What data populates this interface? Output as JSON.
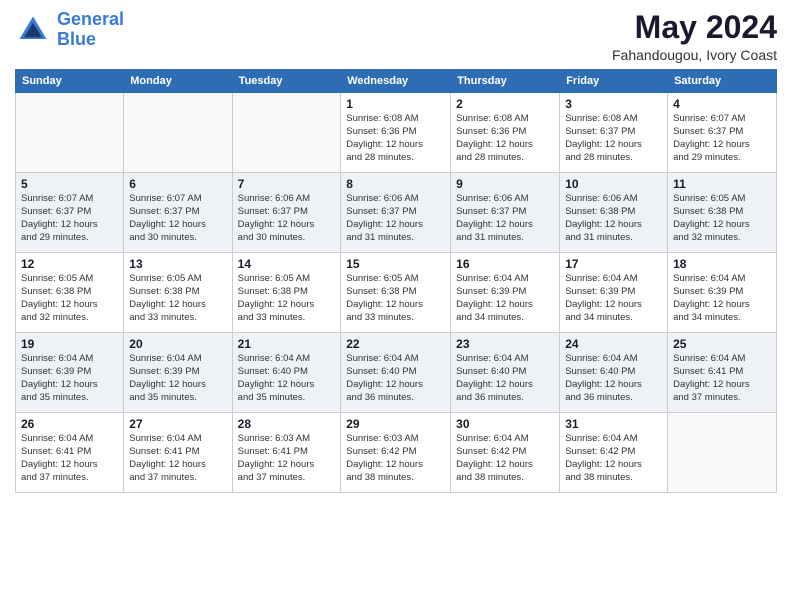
{
  "header": {
    "logo_line1": "General",
    "logo_line2": "Blue",
    "month": "May 2024",
    "location": "Fahandougou, Ivory Coast"
  },
  "weekdays": [
    "Sunday",
    "Monday",
    "Tuesday",
    "Wednesday",
    "Thursday",
    "Friday",
    "Saturday"
  ],
  "weeks": [
    [
      {
        "day": "",
        "info": ""
      },
      {
        "day": "",
        "info": ""
      },
      {
        "day": "",
        "info": ""
      },
      {
        "day": "1",
        "info": "Sunrise: 6:08 AM\nSunset: 6:36 PM\nDaylight: 12 hours\nand 28 minutes."
      },
      {
        "day": "2",
        "info": "Sunrise: 6:08 AM\nSunset: 6:36 PM\nDaylight: 12 hours\nand 28 minutes."
      },
      {
        "day": "3",
        "info": "Sunrise: 6:08 AM\nSunset: 6:37 PM\nDaylight: 12 hours\nand 28 minutes."
      },
      {
        "day": "4",
        "info": "Sunrise: 6:07 AM\nSunset: 6:37 PM\nDaylight: 12 hours\nand 29 minutes."
      }
    ],
    [
      {
        "day": "5",
        "info": "Sunrise: 6:07 AM\nSunset: 6:37 PM\nDaylight: 12 hours\nand 29 minutes."
      },
      {
        "day": "6",
        "info": "Sunrise: 6:07 AM\nSunset: 6:37 PM\nDaylight: 12 hours\nand 30 minutes."
      },
      {
        "day": "7",
        "info": "Sunrise: 6:06 AM\nSunset: 6:37 PM\nDaylight: 12 hours\nand 30 minutes."
      },
      {
        "day": "8",
        "info": "Sunrise: 6:06 AM\nSunset: 6:37 PM\nDaylight: 12 hours\nand 31 minutes."
      },
      {
        "day": "9",
        "info": "Sunrise: 6:06 AM\nSunset: 6:37 PM\nDaylight: 12 hours\nand 31 minutes."
      },
      {
        "day": "10",
        "info": "Sunrise: 6:06 AM\nSunset: 6:38 PM\nDaylight: 12 hours\nand 31 minutes."
      },
      {
        "day": "11",
        "info": "Sunrise: 6:05 AM\nSunset: 6:38 PM\nDaylight: 12 hours\nand 32 minutes."
      }
    ],
    [
      {
        "day": "12",
        "info": "Sunrise: 6:05 AM\nSunset: 6:38 PM\nDaylight: 12 hours\nand 32 minutes."
      },
      {
        "day": "13",
        "info": "Sunrise: 6:05 AM\nSunset: 6:38 PM\nDaylight: 12 hours\nand 33 minutes."
      },
      {
        "day": "14",
        "info": "Sunrise: 6:05 AM\nSunset: 6:38 PM\nDaylight: 12 hours\nand 33 minutes."
      },
      {
        "day": "15",
        "info": "Sunrise: 6:05 AM\nSunset: 6:38 PM\nDaylight: 12 hours\nand 33 minutes."
      },
      {
        "day": "16",
        "info": "Sunrise: 6:04 AM\nSunset: 6:39 PM\nDaylight: 12 hours\nand 34 minutes."
      },
      {
        "day": "17",
        "info": "Sunrise: 6:04 AM\nSunset: 6:39 PM\nDaylight: 12 hours\nand 34 minutes."
      },
      {
        "day": "18",
        "info": "Sunrise: 6:04 AM\nSunset: 6:39 PM\nDaylight: 12 hours\nand 34 minutes."
      }
    ],
    [
      {
        "day": "19",
        "info": "Sunrise: 6:04 AM\nSunset: 6:39 PM\nDaylight: 12 hours\nand 35 minutes."
      },
      {
        "day": "20",
        "info": "Sunrise: 6:04 AM\nSunset: 6:39 PM\nDaylight: 12 hours\nand 35 minutes."
      },
      {
        "day": "21",
        "info": "Sunrise: 6:04 AM\nSunset: 6:40 PM\nDaylight: 12 hours\nand 35 minutes."
      },
      {
        "day": "22",
        "info": "Sunrise: 6:04 AM\nSunset: 6:40 PM\nDaylight: 12 hours\nand 36 minutes."
      },
      {
        "day": "23",
        "info": "Sunrise: 6:04 AM\nSunset: 6:40 PM\nDaylight: 12 hours\nand 36 minutes."
      },
      {
        "day": "24",
        "info": "Sunrise: 6:04 AM\nSunset: 6:40 PM\nDaylight: 12 hours\nand 36 minutes."
      },
      {
        "day": "25",
        "info": "Sunrise: 6:04 AM\nSunset: 6:41 PM\nDaylight: 12 hours\nand 37 minutes."
      }
    ],
    [
      {
        "day": "26",
        "info": "Sunrise: 6:04 AM\nSunset: 6:41 PM\nDaylight: 12 hours\nand 37 minutes."
      },
      {
        "day": "27",
        "info": "Sunrise: 6:04 AM\nSunset: 6:41 PM\nDaylight: 12 hours\nand 37 minutes."
      },
      {
        "day": "28",
        "info": "Sunrise: 6:03 AM\nSunset: 6:41 PM\nDaylight: 12 hours\nand 37 minutes."
      },
      {
        "day": "29",
        "info": "Sunrise: 6:03 AM\nSunset: 6:42 PM\nDaylight: 12 hours\nand 38 minutes."
      },
      {
        "day": "30",
        "info": "Sunrise: 6:04 AM\nSunset: 6:42 PM\nDaylight: 12 hours\nand 38 minutes."
      },
      {
        "day": "31",
        "info": "Sunrise: 6:04 AM\nSunset: 6:42 PM\nDaylight: 12 hours\nand 38 minutes."
      },
      {
        "day": "",
        "info": ""
      }
    ]
  ]
}
